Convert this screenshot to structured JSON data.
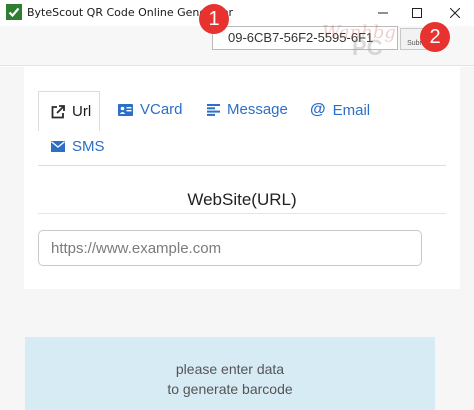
{
  "window": {
    "title": "ByteScout QR Code Online Generator",
    "minimize_label": "—",
    "maximize_label": "□",
    "close_label": "✕"
  },
  "header": {
    "key_value": "09-6CB7-56F2-5595-6F1",
    "submit_label": "Submit",
    "watermark_text": "Wanhbg",
    "watermark_pc": "PC"
  },
  "annotations": {
    "badge_1": "1",
    "badge_2": "2",
    "badge_color": "#e8322f"
  },
  "tabs": [
    {
      "label": "Url",
      "icon": "external-link-icon",
      "active": true
    },
    {
      "label": "VCard",
      "icon": "contact-card-icon",
      "active": false
    },
    {
      "label": "Message",
      "icon": "align-left-icon",
      "active": false
    },
    {
      "label": "Email",
      "icon": "at-sign-icon",
      "active": false
    },
    {
      "label": "SMS",
      "icon": "envelope-icon",
      "active": false
    }
  ],
  "form": {
    "title": "WebSite(URL)",
    "url_placeholder": "https://www.example.com",
    "url_value": ""
  },
  "result": {
    "line1": "please enter data",
    "line2": "to generate barcode"
  },
  "colors": {
    "accent": "#2b6fc7",
    "result_bg": "#d7ebf4",
    "content_bg": "#f6f6f6"
  }
}
